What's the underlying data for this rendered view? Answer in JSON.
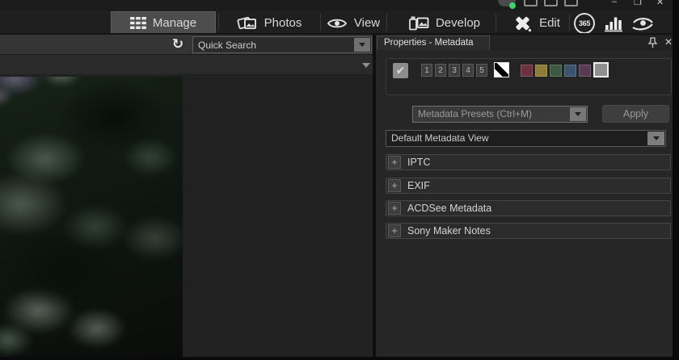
{
  "window": {
    "minimize_glyph": "–",
    "restore_glyph": "❐",
    "close_glyph": "✕",
    "sync_status_color": "#3fd46a"
  },
  "top_nav": {
    "tabs": [
      {
        "label": "Manage",
        "icon": "grid-icon",
        "active": true
      },
      {
        "label": "Photos",
        "icon": "photos-icon",
        "active": false
      },
      {
        "label": "View",
        "icon": "eye-icon",
        "active": false
      },
      {
        "label": "Develop",
        "icon": "develop-icon",
        "active": false
      },
      {
        "label": "Edit",
        "icon": "edit-icon",
        "active": false
      }
    ],
    "badge_365": "365",
    "active_tab_bg": "#4d4d4d"
  },
  "toolbar": {
    "search_placeholder": "Quick Search"
  },
  "properties_panel": {
    "tab_title": "Properties - Metadata",
    "close_glyph": "✕",
    "checkbox_checked": true,
    "check_glyph": "✔",
    "ratings": [
      "1",
      "2",
      "3",
      "4",
      "5"
    ],
    "label_colors": [
      "#6d3240",
      "#8f7c36",
      "#3c5a44",
      "#3a566e",
      "#593a55",
      "#8f8f8f"
    ],
    "selected_label_color_index": 5,
    "presets_dropdown_value": "Metadata Presets (Ctrl+M)",
    "apply_label": "Apply",
    "view_dropdown_value": "Default Metadata View",
    "expand_glyph": "+",
    "sections": [
      {
        "label": "IPTC"
      },
      {
        "label": "EXIF"
      },
      {
        "label": "ACDSee Metadata"
      },
      {
        "label": "Sony Maker Notes"
      }
    ]
  }
}
